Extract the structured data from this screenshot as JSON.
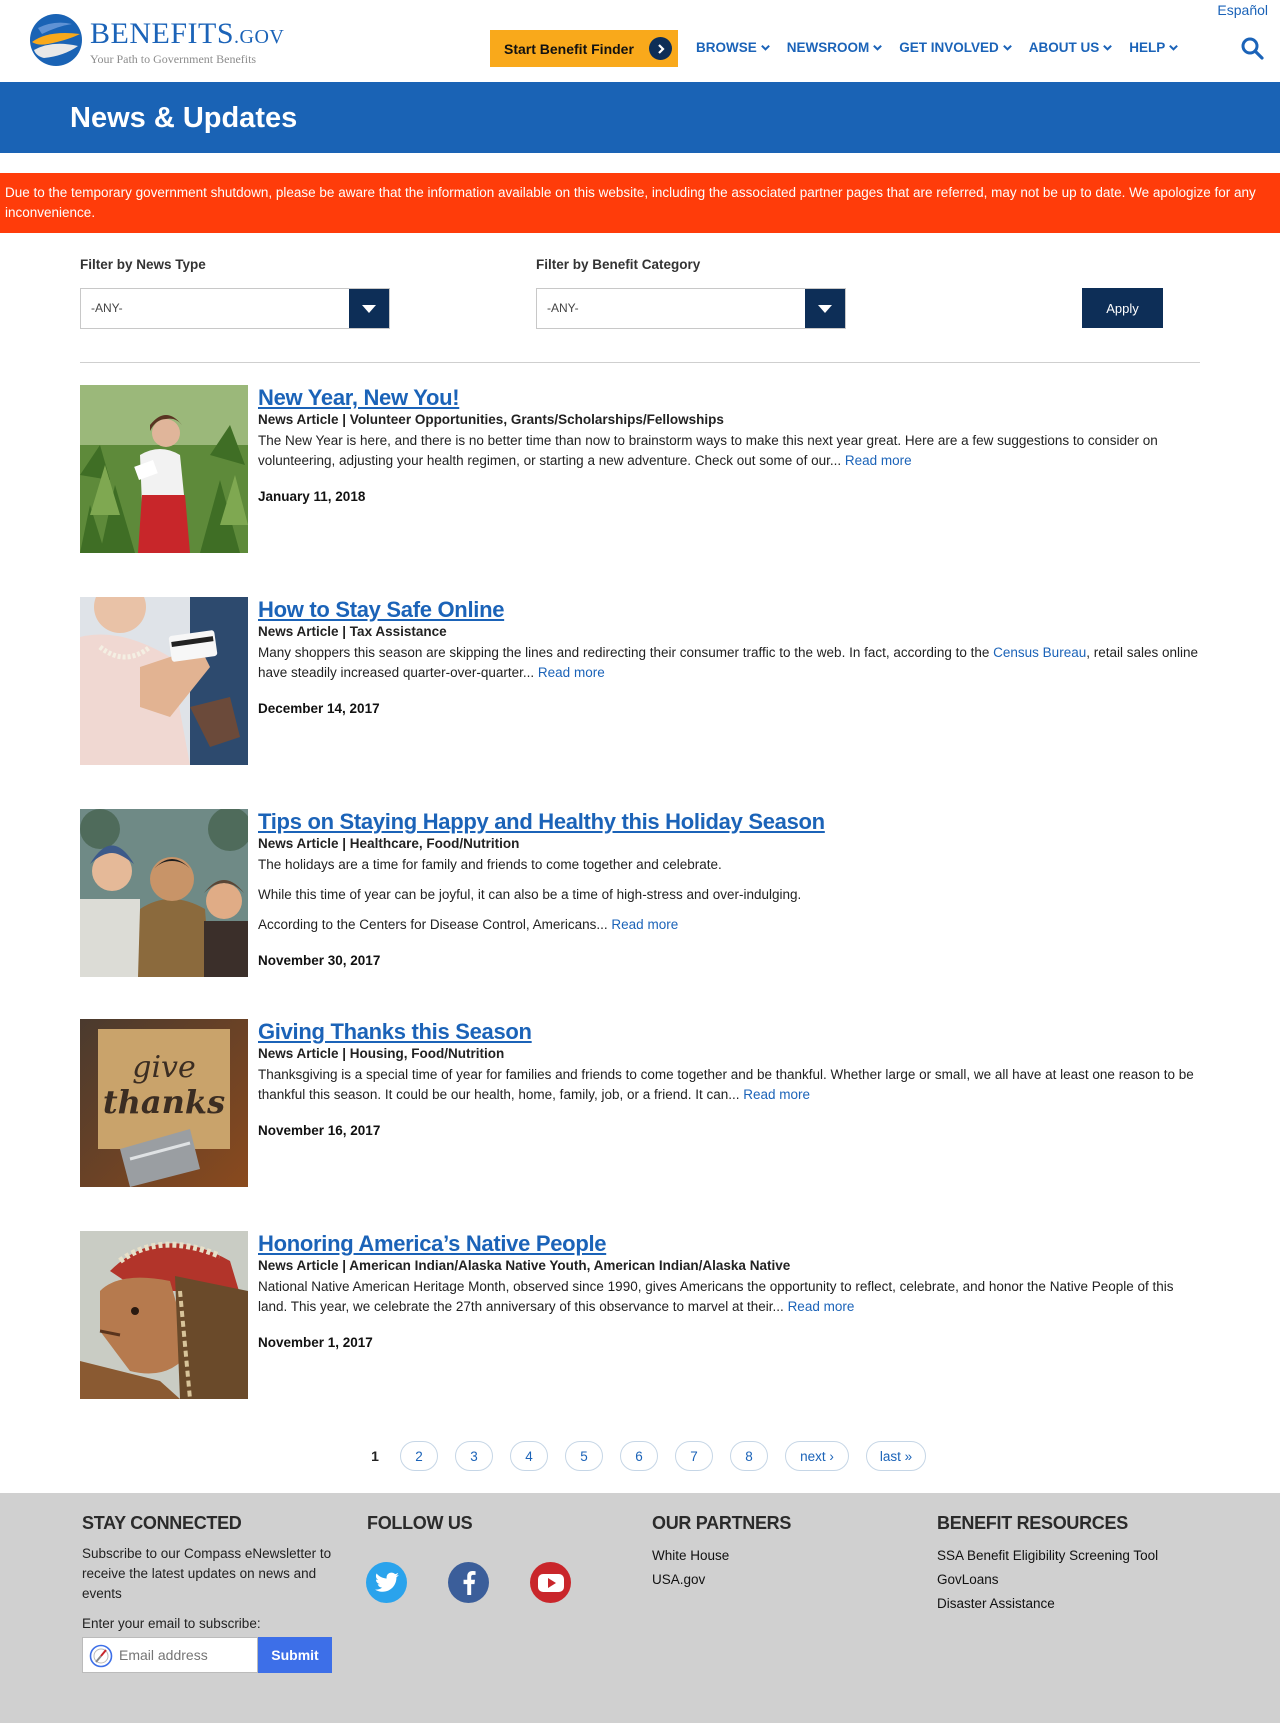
{
  "header": {
    "language_link": "Español",
    "logo_main": "BENEFITS",
    "logo_suffix": ".GOV",
    "logo_tagline": "Your Path to Government Benefits",
    "cta_label": "Start Benefit Finder",
    "nav": [
      "BROWSE",
      "NEWSROOM",
      "GET INVOLVED",
      "ABOUT US",
      "HELP"
    ]
  },
  "banner": {
    "title": "News & Updates"
  },
  "alert": {
    "text": "Due to the temporary government shutdown, please be aware that the information available on this website, including the associated partner pages that are referred, may not be up to date. We apologize for any inconvenience."
  },
  "filters": {
    "news_type_label": "Filter by News Type",
    "news_type_value": "-ANY-",
    "category_label": "Filter by Benefit Category",
    "category_value": "-ANY-",
    "apply_label": "Apply"
  },
  "articles": [
    {
      "title": "New Year, New You!",
      "meta": "News Article | Volunteer Opportunities, Grants/Scholarships/Fellowships",
      "paragraphs": [
        "The New Year is here, and there is no better time than now to brainstorm ways to make this next year great. Here are a few suggestions to consider on volunteering, adjusting your health regimen, or starting a new adventure. Check out some of our..."
      ],
      "read_more": "Read more",
      "date": "January 11, 2018"
    },
    {
      "title": "How to Stay Safe Online",
      "meta": "News Article | Tax Assistance",
      "paragraph_pre": "Many shoppers this season are skipping the lines and redirecting their consumer traffic to the web. In fact, according to the ",
      "paragraph_link": "Census Bureau",
      "paragraph_post": ", retail sales online have steadily increased quarter-over-quarter...",
      "read_more": "Read more",
      "date": "December 14, 2017"
    },
    {
      "title": "Tips on Staying Happy and Healthy this Holiday Season",
      "meta": "News Article | Healthcare, Food/Nutrition",
      "paragraphs": [
        "The holidays are a time for family and friends to come together and celebrate.",
        "While this time of year can be joyful, it can also be a time of high-stress and over-indulging.",
        "According to the Centers for Disease Control, Americans..."
      ],
      "read_more": "Read more",
      "date": "November 30, 2017"
    },
    {
      "title": "Giving Thanks this Season",
      "meta": "News Article | Housing, Food/Nutrition",
      "paragraphs": [
        "Thanksgiving is a special time of year for families and friends to come together and be thankful. Whether large or small, we all have at least one reason to be thankful this season. It could be our health, home, family, job, or a friend. It can..."
      ],
      "read_more": "Read more",
      "date": "November 16, 2017",
      "thumb_words": [
        "give",
        "thanks"
      ]
    },
    {
      "title": "Honoring America’s Native People",
      "meta": "News Article | American Indian/Alaska Native Youth, American Indian/Alaska Native",
      "paragraphs": [
        "National Native American Heritage Month, observed since 1990, gives Americans the opportunity to reflect, celebrate, and honor the Native People of this land. This year, we celebrate the 27th anniversary of this observance to marvel at their..."
      ],
      "read_more": "Read more",
      "date": "November 1, 2017"
    }
  ],
  "pager": {
    "current": "1",
    "pages": [
      "2",
      "3",
      "4",
      "5",
      "6",
      "7",
      "8"
    ],
    "next": "next ›",
    "last": "last »"
  },
  "footer": {
    "stay_connected": {
      "heading": "STAY CONNECTED",
      "text": "Subscribe to our Compass eNewsletter to receive the latest updates on news and events",
      "email_label": "Enter your email to subscribe:",
      "email_placeholder": "Email address",
      "submit": "Submit"
    },
    "follow_us": {
      "heading": "FOLLOW US",
      "icons": [
        "twitter-icon",
        "facebook-icon",
        "youtube-icon"
      ]
    },
    "partners": {
      "heading": "OUR PARTNERS",
      "links": [
        "White House",
        "USA.gov"
      ]
    },
    "resources": {
      "heading": "BENEFIT RESOURCES",
      "links": [
        "SSA Benefit Eligibility Screening Tool",
        "GovLoans",
        "Disaster Assistance"
      ]
    }
  },
  "colors": {
    "brand_blue": "#1a63b5",
    "navy": "#0d2e57",
    "alert_orange": "#ff3c0a",
    "cta_orange": "#f9a91b",
    "footer_gray": "#d0d0d0"
  }
}
